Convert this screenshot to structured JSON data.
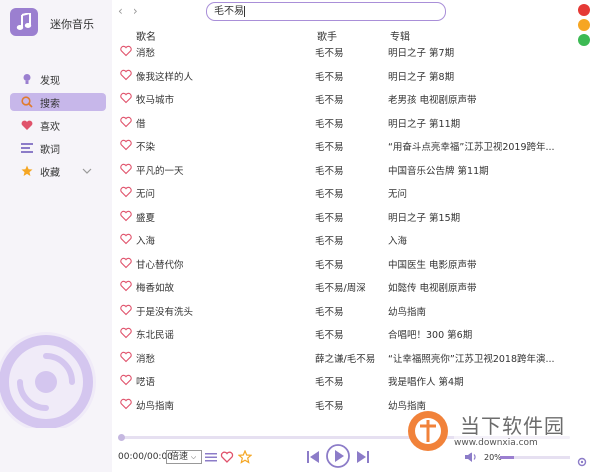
{
  "app": {
    "title": "迷你音乐"
  },
  "nav": [
    {
      "label": "发现",
      "icon": "lightbulb-icon"
    },
    {
      "label": "搜索",
      "icon": "search-icon"
    },
    {
      "label": "喜欢",
      "icon": "heart-icon"
    },
    {
      "label": "歌词",
      "icon": "lyrics-icon"
    },
    {
      "label": "收藏",
      "icon": "star-icon"
    }
  ],
  "search": {
    "value": "毛不易"
  },
  "table": {
    "headers": [
      "歌名",
      "歌手",
      "专辑"
    ],
    "rows": [
      {
        "song": "消愁",
        "artist": "毛不易",
        "album": "明日之子 第7期"
      },
      {
        "song": "像我这样的人",
        "artist": "毛不易",
        "album": "明日之子 第8期"
      },
      {
        "song": "牧马城市",
        "artist": "毛不易",
        "album": "老男孩 电视剧原声带"
      },
      {
        "song": "借",
        "artist": "毛不易",
        "album": "明日之子 第11期"
      },
      {
        "song": "不染",
        "artist": "毛不易",
        "album": "“用奋斗点亮幸福”江苏卫视2019跨年..."
      },
      {
        "song": "平凡的一天",
        "artist": "毛不易",
        "album": "中国音乐公告牌 第11期"
      },
      {
        "song": "无问",
        "artist": "毛不易",
        "album": "无问"
      },
      {
        "song": "盛夏",
        "artist": "毛不易",
        "album": "明日之子 第15期"
      },
      {
        "song": "入海",
        "artist": "毛不易",
        "album": "入海"
      },
      {
        "song": "甘心替代你",
        "artist": "毛不易",
        "album": "中国医生 电影原声带"
      },
      {
        "song": "梅香如故",
        "artist": "毛不易/周深",
        "album": "如懿传 电视剧原声带"
      },
      {
        "song": "于是没有洗头",
        "artist": "毛不易",
        "album": "幼鸟指南"
      },
      {
        "song": "东北民谣",
        "artist": "毛不易",
        "album": "合唱吧！300 第6期"
      },
      {
        "song": "消愁",
        "artist": "薛之谦/毛不易",
        "album": "“让幸福照亮你”江苏卫视2018跨年演..."
      },
      {
        "song": "呓语",
        "artist": "毛不易",
        "album": "我是唱作人 第4期"
      },
      {
        "song": "幼鸟指南",
        "artist": "毛不易",
        "album": "幼鸟指南"
      }
    ]
  },
  "player": {
    "time": "00:00/00:00",
    "mode": "倍速",
    "volume_label": "20%",
    "volume_fraction": 0.2,
    "progress_fraction": 0.0
  },
  "watermark": {
    "name": "当下软件园",
    "url": "www.downxia.com"
  },
  "colors": {
    "accent": "#9b7fd0",
    "heart": "#e0526b",
    "close": "#e53935",
    "minimize": "#f6a623",
    "maximize": "#3cba54"
  }
}
